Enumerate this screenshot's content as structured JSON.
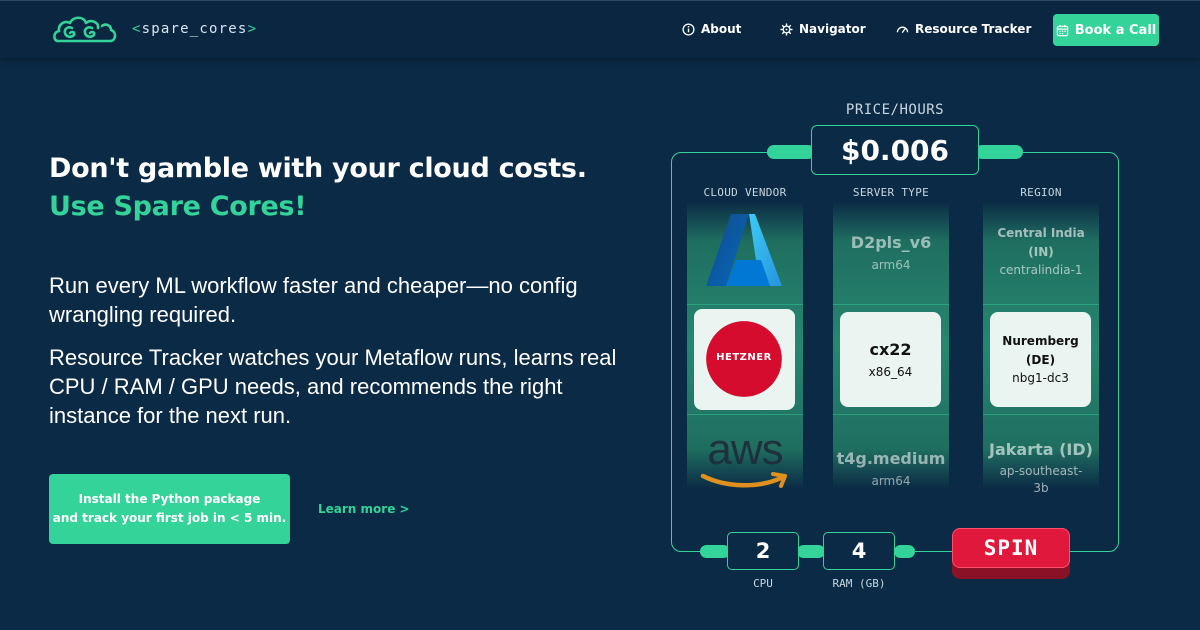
{
  "header": {
    "brand": {
      "open": "<",
      "name": "spare_cores",
      "close": ">"
    },
    "nav": [
      {
        "label": "About",
        "icon": "info-circle-icon"
      },
      {
        "label": "Navigator",
        "icon": "compass-icon"
      },
      {
        "label": "Resource Tracker",
        "icon": "gauge-icon"
      }
    ],
    "book_call": {
      "label": "Book a Call",
      "icon": "calendar-icon"
    }
  },
  "hero": {
    "headline": "Don't gamble with your cloud costs.",
    "headline_accent": "Use Spare Cores!",
    "paragraph_1": "Run every ML workflow faster and cheaper—no config wrangling required.",
    "paragraph_2": "Resource Tracker watches your Metaflow runs, learns real CPU / RAM / GPU needs, and recommends the right instance for the next run.",
    "cta_line_1": "Install the Python package",
    "cta_line_2": "and track your first job in < 5 min.",
    "learn_more": "Learn more >"
  },
  "slot_machine": {
    "price_label": "PRICE/HOURS",
    "price": "$0.006",
    "columns": {
      "vendor": "CLOUD VENDOR",
      "server": "SERVER TYPE",
      "region": "REGION"
    },
    "vendors": [
      {
        "name": "Azure",
        "logo": "azure-logo"
      },
      {
        "name": "HETZNER",
        "logo": "hetzner-logo"
      },
      {
        "name": "aws",
        "logo": "aws-logo"
      }
    ],
    "servers": [
      {
        "type": "D2pls_v6",
        "arch": "arm64"
      },
      {
        "type": "cx22",
        "arch": "x86_64"
      },
      {
        "type": "t4g.medium",
        "arch": "arm64"
      }
    ],
    "regions": [
      {
        "name_1": "Central India",
        "name_2": "(IN)",
        "code_1": "centralindia-1",
        "code_2": ""
      },
      {
        "name_1": "Nuremberg",
        "name_2": "(DE)",
        "code_1": "nbg1-dc3",
        "code_2": ""
      },
      {
        "name_1": "Jakarta (ID)",
        "name_2": "",
        "code_1": "ap-southeast-",
        "code_2": "3b"
      }
    ],
    "cpu": {
      "value": "2",
      "label": "CPU"
    },
    "ram": {
      "value": "4",
      "label": "RAM (GB)"
    },
    "spin_label": "SPIN"
  },
  "colors": {
    "background": "#0b2a45",
    "accent": "#34d399",
    "spin": "#e0183c"
  }
}
